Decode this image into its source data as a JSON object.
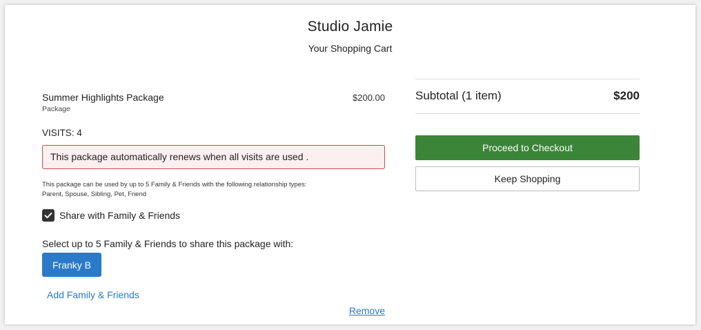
{
  "header": {
    "studio_name": "Studio Jamie",
    "page_title": "Your Shopping Cart"
  },
  "cart_item": {
    "name": "Summer Highlights Package",
    "type": "Package",
    "price": "$200.00",
    "visits_label": "VISITS:",
    "visits_value": "4",
    "renew_notice": "This package automatically renews when all visits are used .",
    "share_info_line1": "This package can be used by up to 5 Family & Friends with the following relationship types:",
    "share_info_line2": "Parent, Spouse, Sibling, Pet, Friend",
    "share_checkbox_label": "Share with Family & Friends",
    "share_checked": true,
    "select_label": "Select up to 5 Family & Friends to share this package with:",
    "selected_friends": [
      "Franky B"
    ],
    "add_friends_label": "Add Family & Friends",
    "remove_label": "Remove"
  },
  "summary": {
    "subtotal_label": "Subtotal (1 item)",
    "subtotal_value": "$200",
    "checkout_label": "Proceed to Checkout",
    "keep_shopping_label": "Keep Shopping"
  },
  "icons": {
    "checkbox": "check-icon"
  },
  "colors": {
    "primary_blue": "#2a7ac9",
    "checkout_green": "#3b8539",
    "alert_border": "#c8484b",
    "alert_background": "#fcefef"
  }
}
